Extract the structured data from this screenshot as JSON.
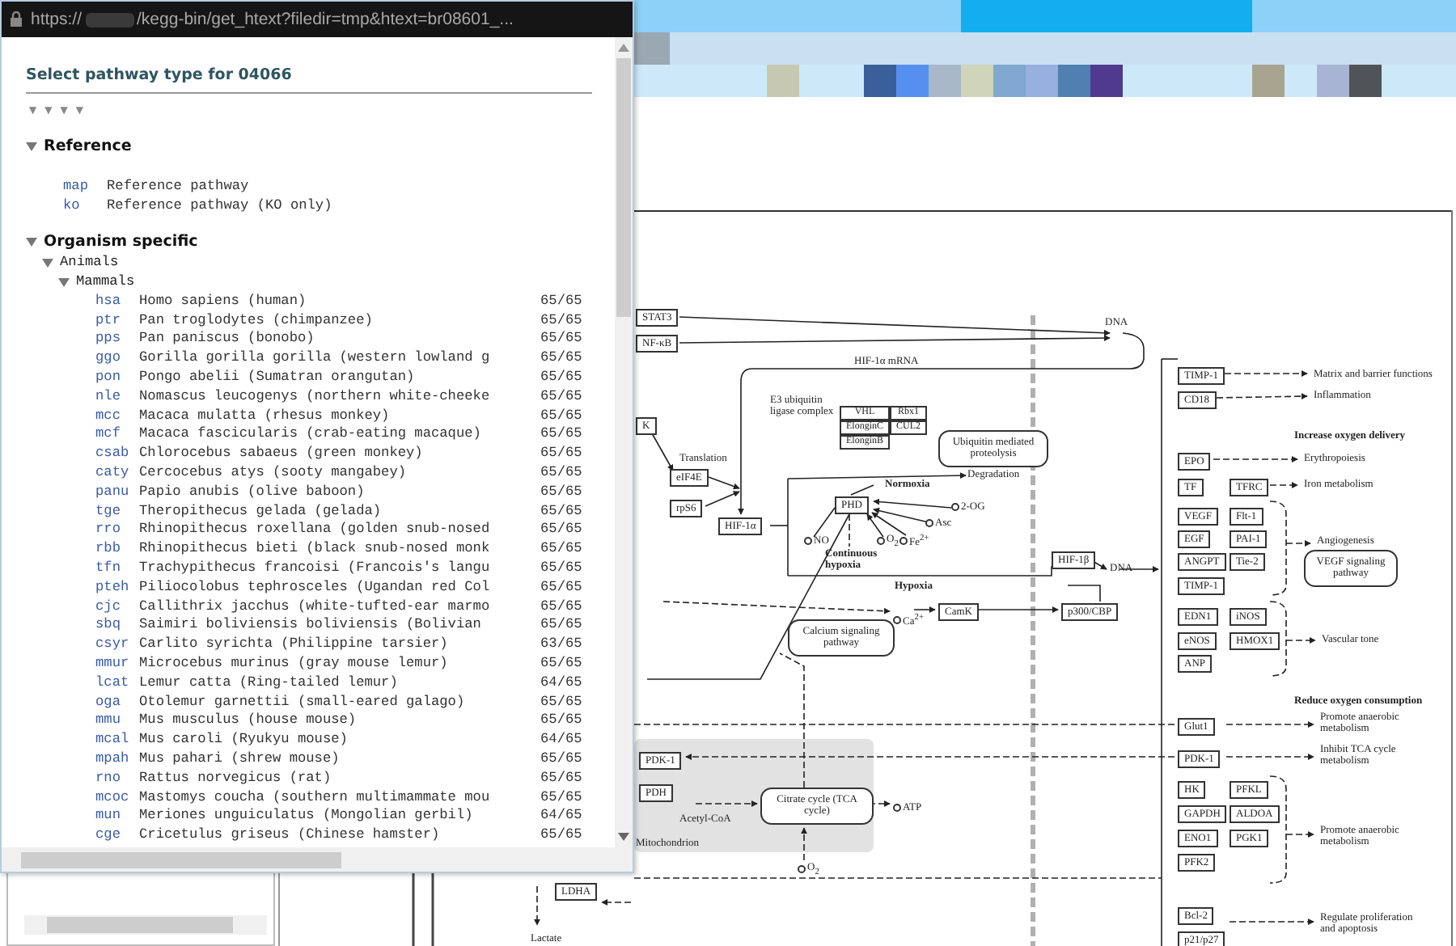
{
  "browser_bar": {
    "scheme": "https://",
    "path": "/kegg-bin/get_htext?filedir=tmp&htext=br08601_..."
  },
  "popup": {
    "title": "Select pathway type for 04066",
    "level_toggles": [
      {
        "symbol": "▼"
      },
      {
        "symbol": "▼"
      },
      {
        "symbol": "▼"
      },
      {
        "symbol": "▼"
      }
    ],
    "tree": [
      {
        "label": "Reference",
        "expanded": true,
        "entries": [
          {
            "code": "map",
            "name": "Reference pathway"
          },
          {
            "code": "ko",
            "name": "Reference pathway (KO only)"
          }
        ]
      },
      {
        "label": "Organism specific",
        "expanded": true,
        "children": [
          {
            "label": "Animals",
            "expanded": true,
            "children": [
              {
                "label": "Mammals",
                "expanded": true,
                "entries": [
                  {
                    "code": "hsa",
                    "name": "Homo sapiens (human)",
                    "score": "65/65"
                  },
                  {
                    "code": "ptr",
                    "name": "Pan troglodytes (chimpanzee)",
                    "score": "65/65"
                  },
                  {
                    "code": "pps",
                    "name": "Pan paniscus (bonobo)",
                    "score": "65/65"
                  },
                  {
                    "code": "ggo",
                    "name": "Gorilla gorilla gorilla (western lowland g",
                    "score": "65/65"
                  },
                  {
                    "code": "pon",
                    "name": "Pongo abelii (Sumatran orangutan)",
                    "score": "65/65"
                  },
                  {
                    "code": "nle",
                    "name": "Nomascus leucogenys (northern white-cheeke",
                    "score": "65/65"
                  },
                  {
                    "code": "mcc",
                    "name": "Macaca mulatta (rhesus monkey)",
                    "score": "65/65"
                  },
                  {
                    "code": "mcf",
                    "name": "Macaca fascicularis (crab-eating macaque)",
                    "score": "65/65"
                  },
                  {
                    "code": "csab",
                    "name": "Chlorocebus sabaeus (green monkey)",
                    "score": "65/65"
                  },
                  {
                    "code": "caty",
                    "name": "Cercocebus atys (sooty mangabey)",
                    "score": "65/65"
                  },
                  {
                    "code": "panu",
                    "name": "Papio anubis (olive baboon)",
                    "score": "65/65"
                  },
                  {
                    "code": "tge",
                    "name": "Theropithecus gelada (gelada)",
                    "score": "65/65"
                  },
                  {
                    "code": "rro",
                    "name": "Rhinopithecus roxellana (golden snub-nosed",
                    "score": "65/65"
                  },
                  {
                    "code": "rbb",
                    "name": "Rhinopithecus bieti (black snub-nosed monk",
                    "score": "65/65"
                  },
                  {
                    "code": "tfn",
                    "name": "Trachypithecus francoisi (Francois's langu",
                    "score": "65/65"
                  },
                  {
                    "code": "pteh",
                    "name": "Piliocolobus tephrosceles (Ugandan red Col",
                    "score": "65/65"
                  },
                  {
                    "code": "cjc",
                    "name": "Callithrix jacchus (white-tufted-ear marmo",
                    "score": "65/65"
                  },
                  {
                    "code": "sbq",
                    "name": "Saimiri boliviensis boliviensis (Bolivian",
                    "score": "65/65"
                  },
                  {
                    "code": "csyr",
                    "name": "Carlito syrichta (Philippine tarsier)",
                    "score": "63/65"
                  },
                  {
                    "code": "mmur",
                    "name": "Microcebus murinus (gray mouse lemur)",
                    "score": "65/65"
                  },
                  {
                    "code": "lcat",
                    "name": "Lemur catta (Ring-tailed lemur)",
                    "score": "64/65"
                  },
                  {
                    "code": "oga",
                    "name": "Otolemur garnettii (small-eared galago)",
                    "score": "65/65"
                  },
                  {
                    "code": "mmu",
                    "name": "Mus musculus (house mouse)",
                    "score": "65/65"
                  },
                  {
                    "code": "mcal",
                    "name": "Mus caroli (Ryukyu mouse)",
                    "score": "64/65"
                  },
                  {
                    "code": "mpah",
                    "name": "Mus pahari (shrew mouse)",
                    "score": "65/65"
                  },
                  {
                    "code": "rno",
                    "name": "Rattus norvegicus (rat)",
                    "score": "65/65"
                  },
                  {
                    "code": "mcoc",
                    "name": "Mastomys coucha (southern multimammate mou",
                    "score": "65/65"
                  },
                  {
                    "code": "mun",
                    "name": "Meriones unguiculatus (Mongolian gerbil)",
                    "score": "64/65"
                  },
                  {
                    "code": "cge",
                    "name": "Cricetulus griseus (Chinese hamster)",
                    "score": "65/65"
                  }
                ]
              }
            ]
          }
        ]
      }
    ]
  },
  "diagram": {
    "nodes": [
      {
        "text": "STAT3",
        "kind": "box"
      },
      {
        "text": "NF-κB",
        "kind": "box"
      },
      {
        "text": "HIF-1α mRNA",
        "kind": "label"
      },
      {
        "text": "DNA",
        "kind": "label"
      },
      {
        "text": "E3 ubiquitin ligase complex",
        "kind": "label"
      },
      {
        "text": "VHL",
        "kind": "box"
      },
      {
        "text": "Rbx1",
        "kind": "box"
      },
      {
        "text": "ElonginC",
        "kind": "box"
      },
      {
        "text": "CUL2",
        "kind": "box"
      },
      {
        "text": "ElonginB",
        "kind": "box"
      },
      {
        "text": "Ubiquitin mediated proteolysis",
        "kind": "round"
      },
      {
        "text": "Translation",
        "kind": "label"
      },
      {
        "text": "K",
        "kind": "box"
      },
      {
        "text": "eIF4E",
        "kind": "box"
      },
      {
        "text": "rpS6",
        "kind": "box"
      },
      {
        "text": "HIF-1α",
        "kind": "box"
      },
      {
        "text": "PHD",
        "kind": "box"
      },
      {
        "text": "Normoxia",
        "kind": "bold"
      },
      {
        "text": "Degradation",
        "kind": "label"
      },
      {
        "text": "2-OG",
        "kind": "metabolite"
      },
      {
        "text": "Asc",
        "kind": "metabolite"
      },
      {
        "text": "NO",
        "kind": "metabolite"
      },
      {
        "text": "O$_{2}$",
        "kind": "metabolite"
      },
      {
        "text": "Fe$^{2+}$",
        "kind": "metabolite"
      },
      {
        "text": "Continuous hypoxia",
        "kind": "bold"
      },
      {
        "text": "Hypoxia",
        "kind": "bold"
      },
      {
        "text": "HIF-1β",
        "kind": "box"
      },
      {
        "text": "DNA",
        "kind": "label"
      },
      {
        "text": "CamK",
        "kind": "box"
      },
      {
        "text": "p300/CBP",
        "kind": "box"
      },
      {
        "text": "Ca$^{2+}$",
        "kind": "metabolite"
      },
      {
        "text": "Calcium signaling pathway",
        "kind": "round"
      },
      {
        "text": "PDK-1",
        "kind": "box"
      },
      {
        "text": "PDH",
        "kind": "box"
      },
      {
        "text": "Acetyl-CoA",
        "kind": "label"
      },
      {
        "text": "Citrate cycle (TCA cycle)",
        "kind": "round"
      },
      {
        "text": "ATP",
        "kind": "metabolite"
      },
      {
        "text": "Mitochondrion",
        "kind": "label"
      },
      {
        "text": "O$_{2}$",
        "kind": "metabolite"
      },
      {
        "text": "LDHA",
        "kind": "box"
      },
      {
        "text": "Lactate",
        "kind": "label"
      },
      {
        "text": "TIMP-1",
        "kind": "box"
      },
      {
        "text": "CD18",
        "kind": "box"
      },
      {
        "text": "Matrix and barrier functions",
        "kind": "label"
      },
      {
        "text": "Inflammation",
        "kind": "label"
      },
      {
        "text": "Increase oxygen delivery",
        "kind": "bold"
      },
      {
        "text": "EPO",
        "kind": "box"
      },
      {
        "text": "Erythropoiesis",
        "kind": "label"
      },
      {
        "text": "TF",
        "kind": "box"
      },
      {
        "text": "TFRC",
        "kind": "box"
      },
      {
        "text": "Iron metabolism",
        "kind": "label"
      },
      {
        "text": "VEGF",
        "kind": "box"
      },
      {
        "text": "Flt-1",
        "kind": "box"
      },
      {
        "text": "EGF",
        "kind": "box"
      },
      {
        "text": "PAI-1",
        "kind": "box"
      },
      {
        "text": "ANGPT",
        "kind": "box"
      },
      {
        "text": "Tie-2",
        "kind": "box"
      },
      {
        "text": "TIMP-1",
        "kind": "box"
      },
      {
        "text": "Angiogenesis",
        "kind": "label"
      },
      {
        "text": "VEGF signaling pathway",
        "kind": "round"
      },
      {
        "text": "EDN1",
        "kind": "box"
      },
      {
        "text": "iNOS",
        "kind": "box"
      },
      {
        "text": "eNOS",
        "kind": "box"
      },
      {
        "text": "HMOX1",
        "kind": "box"
      },
      {
        "text": "ANP",
        "kind": "box"
      },
      {
        "text": "Vascular tone",
        "kind": "label"
      },
      {
        "text": "Reduce oxygen consumption",
        "kind": "bold"
      },
      {
        "text": "Glut1",
        "kind": "box"
      },
      {
        "text": "Promote anaerobic metabolism",
        "kind": "label"
      },
      {
        "text": "PDK-1",
        "kind": "box"
      },
      {
        "text": "Inhibit TCA cycle metabolism",
        "kind": "label"
      },
      {
        "text": "HK",
        "kind": "box"
      },
      {
        "text": "PFKL",
        "kind": "box"
      },
      {
        "text": "GAPDH",
        "kind": "box"
      },
      {
        "text": "ALDOA",
        "kind": "box"
      },
      {
        "text": "ENO1",
        "kind": "box"
      },
      {
        "text": "PGK1",
        "kind": "box"
      },
      {
        "text": "PFK2",
        "kind": "box"
      },
      {
        "text": "Promote anaerobic metabolism",
        "kind": "label"
      },
      {
        "text": "Bcl-2",
        "kind": "box"
      },
      {
        "text": "p21/p27",
        "kind": "box"
      },
      {
        "text": "Regulate proliferation and apoptosis",
        "kind": "label"
      }
    ]
  }
}
